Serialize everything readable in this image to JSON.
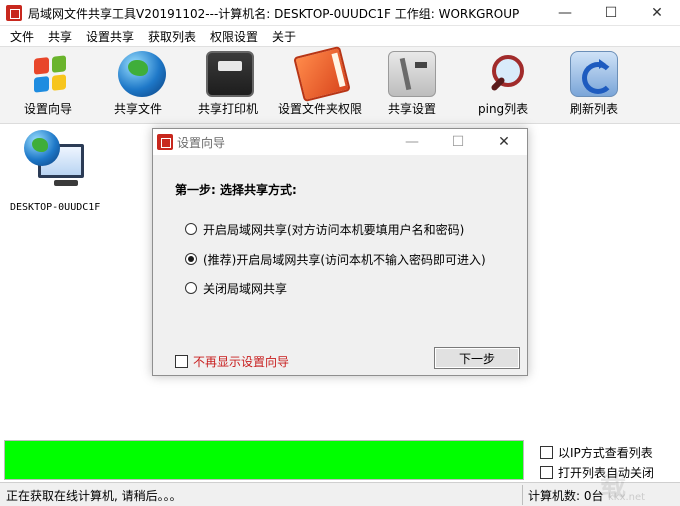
{
  "window": {
    "title": "局域网文件共享工具V20191102---计算机名: DESKTOP-0UUDC1F  工作组: WORKGROUP",
    "minimize": "—",
    "maximize": "☐",
    "close": "✕"
  },
  "menu": [
    "文件",
    "共享",
    "设置共享",
    "获取列表",
    "权限设置",
    "关于"
  ],
  "toolbar": [
    {
      "label": "设置向导",
      "icon": "windows-logo-icon"
    },
    {
      "label": "共享文件",
      "icon": "globe-icon"
    },
    {
      "label": "共享打印机",
      "icon": "printer-icon"
    },
    {
      "label": "设置文件夹权限",
      "icon": "book-icon"
    },
    {
      "label": "共享设置",
      "icon": "tools-icon"
    },
    {
      "label": "ping列表",
      "icon": "magnifier-icon"
    },
    {
      "label": "刷新列表",
      "icon": "refresh-icon"
    }
  ],
  "computer_list": [
    {
      "name": "DESKTOP-0UUDC1F",
      "icon": "network-computer-icon"
    }
  ],
  "dialog": {
    "title": "设置向导",
    "step_title": "第一步: 选择共享方式:",
    "options": [
      {
        "label": "开启局域网共享(对方访问本机要填用户名和密码)",
        "checked": false
      },
      {
        "label": "(推荐)开启局域网共享(访问本机不输入密码即可进入)",
        "checked": true
      },
      {
        "label": "关闭局域网共享",
        "checked": false
      }
    ],
    "dont_show_label": "不再显示设置向导",
    "next_label": "下一步"
  },
  "progress": {
    "value": 1.0,
    "color": "#00ff00"
  },
  "options": {
    "ip_view_label": "以IP方式查看列表",
    "auto_close_label": "打开列表自动关闭"
  },
  "status": {
    "left": "正在获取在线计算机, 请稍后。。。",
    "right": "计算机数: 0台"
  },
  "watermark": {
    "text": "载",
    "url": "kkx.net"
  }
}
